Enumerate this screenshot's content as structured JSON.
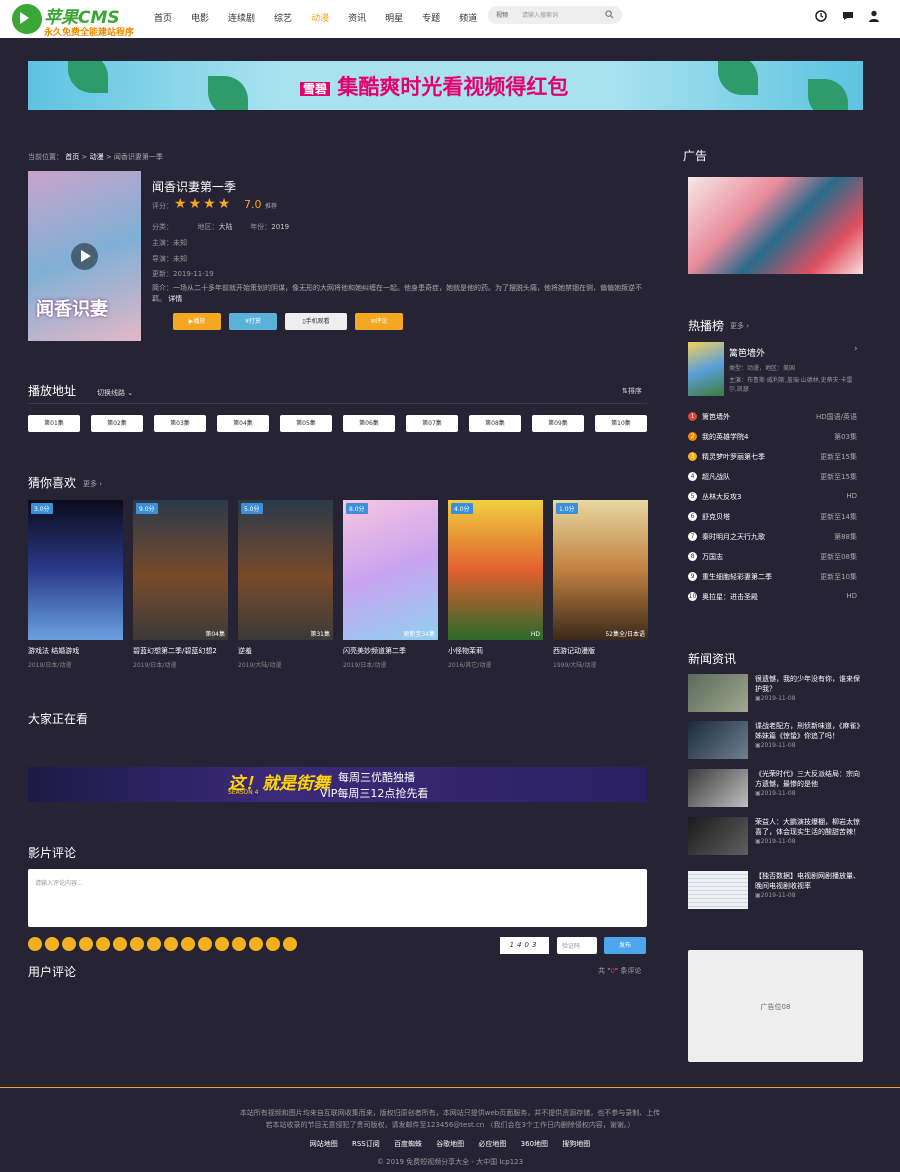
{
  "header": {
    "logo_main": "苹果CMS",
    "logo_sub": "永久免费全能建站程序",
    "nav": [
      "首页",
      "电影",
      "连续剧",
      "综艺",
      "动漫",
      "资讯",
      "明星",
      "专题",
      "频道"
    ],
    "nav_active": 4,
    "search_select": "视频",
    "search_placeholder": "请输入搜索词",
    "icons": [
      "history-icon",
      "message-icon",
      "user-icon"
    ]
  },
  "banner_top": {
    "text": "集酷爽时光看视频得红包",
    "brand": "雪碧"
  },
  "breadcrumb": {
    "prefix": "当前位置：",
    "home": "首页",
    "sep": ">",
    "category": "动漫",
    "current": "闻香识妻第一季"
  },
  "detail": {
    "title": "闻香识妻第一季",
    "score_label": "评分：",
    "score": "7.0",
    "score_suffix": "推荐",
    "stars": 4,
    "category_label": "分类：",
    "region_label": "地区：",
    "region": "大陆",
    "year_label": "年份：",
    "year": "2019",
    "actors_label": "主演：",
    "actors": "未知",
    "director_label": "导演：",
    "director": "未知",
    "update_label": "更新：",
    "update": "2019-11-19",
    "intro_label": "简介：",
    "intro": "一场从二十多年前就开始策划的阴谋，像无形的大网将他和她纠缠在一起。他身患奇症，她就是他的药。为了摆脱头痛，他将她禁锢在侧，偏偏她叛逆不羁。",
    "more": "详情",
    "poster_text": "闻香识妻",
    "buttons": [
      "播放",
      "打赏",
      "手机观看",
      "评论"
    ]
  },
  "playlist": {
    "title": "播放地址",
    "switch": "切换线路",
    "sort": "排序",
    "episodes": [
      "第01集",
      "第02集",
      "第03集",
      "第04集",
      "第05集",
      "第06集",
      "第07集",
      "第08集",
      "第09集",
      "第10集"
    ]
  },
  "guess": {
    "title": "猜你喜欢",
    "more": "更多",
    "items": [
      {
        "score": "3.0分",
        "ep": "",
        "name": "游戏法 结婚游戏",
        "meta": "2019/日本/动漫"
      },
      {
        "score": "9.0分",
        "ep": "第04集",
        "name": "碧蓝幻想第二季/碧蓝幻想2",
        "meta": "2019/日本/动漫"
      },
      {
        "score": "5.0分",
        "ep": "第31集",
        "name": "逆羞",
        "meta": "2019/大陆/动漫"
      },
      {
        "score": "8.0分",
        "ep": "更新至34集",
        "name": "闪亮美妙频道第二季",
        "meta": "2019/日本/动漫"
      },
      {
        "score": "4.0分",
        "ep": "HD",
        "name": "小怪物茉莉",
        "meta": "2016/其它/动漫"
      },
      {
        "score": "1.0分",
        "ep": "52集全/日本语",
        "name": "西游记动漫版",
        "meta": "1999/大陆/动漫"
      }
    ]
  },
  "watching": {
    "title": "大家正在看"
  },
  "banner_mid": {
    "logo": "这！就是街舞",
    "season": "SEASON 4",
    "line1": "每周三优酷独播",
    "line2": "VIP每周三12点抢先看"
  },
  "comment": {
    "title": "影片评论",
    "placeholder": "请输入评论内容...",
    "captcha": "1403",
    "code_placeholder": "验证码",
    "submit": "发布",
    "user_title": "用户评论",
    "count_prefix": "共",
    "count": "0",
    "count_suffix": "条评论"
  },
  "sidebar": {
    "ad_title": "广告",
    "hot_title": "热播榜",
    "hot_more": "更多",
    "hot_top": {
      "name": "篱笆墙外",
      "meta": "类型：动漫，地区：美国",
      "actors": "主演：布鲁斯·威利斯,盖瑞·山德林,史蒂夫·卡雷尔,凯瑟"
    },
    "hot_list": [
      {
        "n": "1",
        "name": "篱笆墙外",
        "status": "HD国语/英语",
        "color": "#e8413a"
      },
      {
        "n": "2",
        "name": "我的英雄学院4",
        "status": "第03集",
        "color": "#f08a00"
      },
      {
        "n": "3",
        "name": "精灵梦叶罗丽第七季",
        "status": "更新至15集",
        "color": "#f5b020"
      },
      {
        "n": "4",
        "name": "超凡战队",
        "status": "更新至15集",
        "color": "#ffffff"
      },
      {
        "n": "5",
        "name": "丛林大反攻3",
        "status": "HD",
        "color": "#ffffff"
      },
      {
        "n": "6",
        "name": "舒克贝塔",
        "status": "更新至14集",
        "color": "#ffffff"
      },
      {
        "n": "7",
        "name": "秦时明月之天行九歌",
        "status": "第88集",
        "color": "#ffffff"
      },
      {
        "n": "8",
        "name": "万国志",
        "status": "更新至08集",
        "color": "#ffffff"
      },
      {
        "n": "9",
        "name": "重生细胞轻彩妻第二季",
        "status": "更新至10集",
        "color": "#ffffff"
      },
      {
        "n": "10",
        "name": "奥拉星：进击圣殿",
        "status": "HD",
        "color": "#ffffff"
      }
    ],
    "news_title": "新闻资讯",
    "news": [
      {
        "title": "很遗憾，我的少年没有你，谁来保护我？",
        "date": "2019-11-08"
      },
      {
        "title": "谍战老配方，刑侦新味道，《麻雀》姊妹篇《惊蛰》你追了吗！",
        "date": "2019-11-08"
      },
      {
        "title": "《光荣时代》三大反派结局：宗向方遗憾，最惨的是他",
        "date": "2019-11-08"
      },
      {
        "title": "荣益人：大鹏演技爆棚，柳岩太惊喜了，体会现实生活的酸甜苦辣！",
        "date": "2019-11-08"
      },
      {
        "title": "【独否数据】电视剧网剧播放量、晚间电视剧收视率",
        "date": "2019-11-08"
      }
    ],
    "ad08": "广告位08"
  },
  "footer": {
    "line1": "本站所有视频和图片均来自互联网收集而来，版权归原创者所有，本网站只提供web页面服务，并不提供资源存储，也不参与录制、上传",
    "line2": "若本站收录的节目无意侵犯了贵司版权，请发邮件至123456@test.cn （我们会在3个工作日内删除侵权内容，谢谢。）",
    "links": [
      "网站地图",
      "RSS订阅",
      "百度蜘蛛",
      "谷歌地图",
      "必应地图",
      "360地图",
      "搜狗地图"
    ],
    "copyright": "© 2019 免费短视频分享大全 - 大中国 Icp123"
  }
}
